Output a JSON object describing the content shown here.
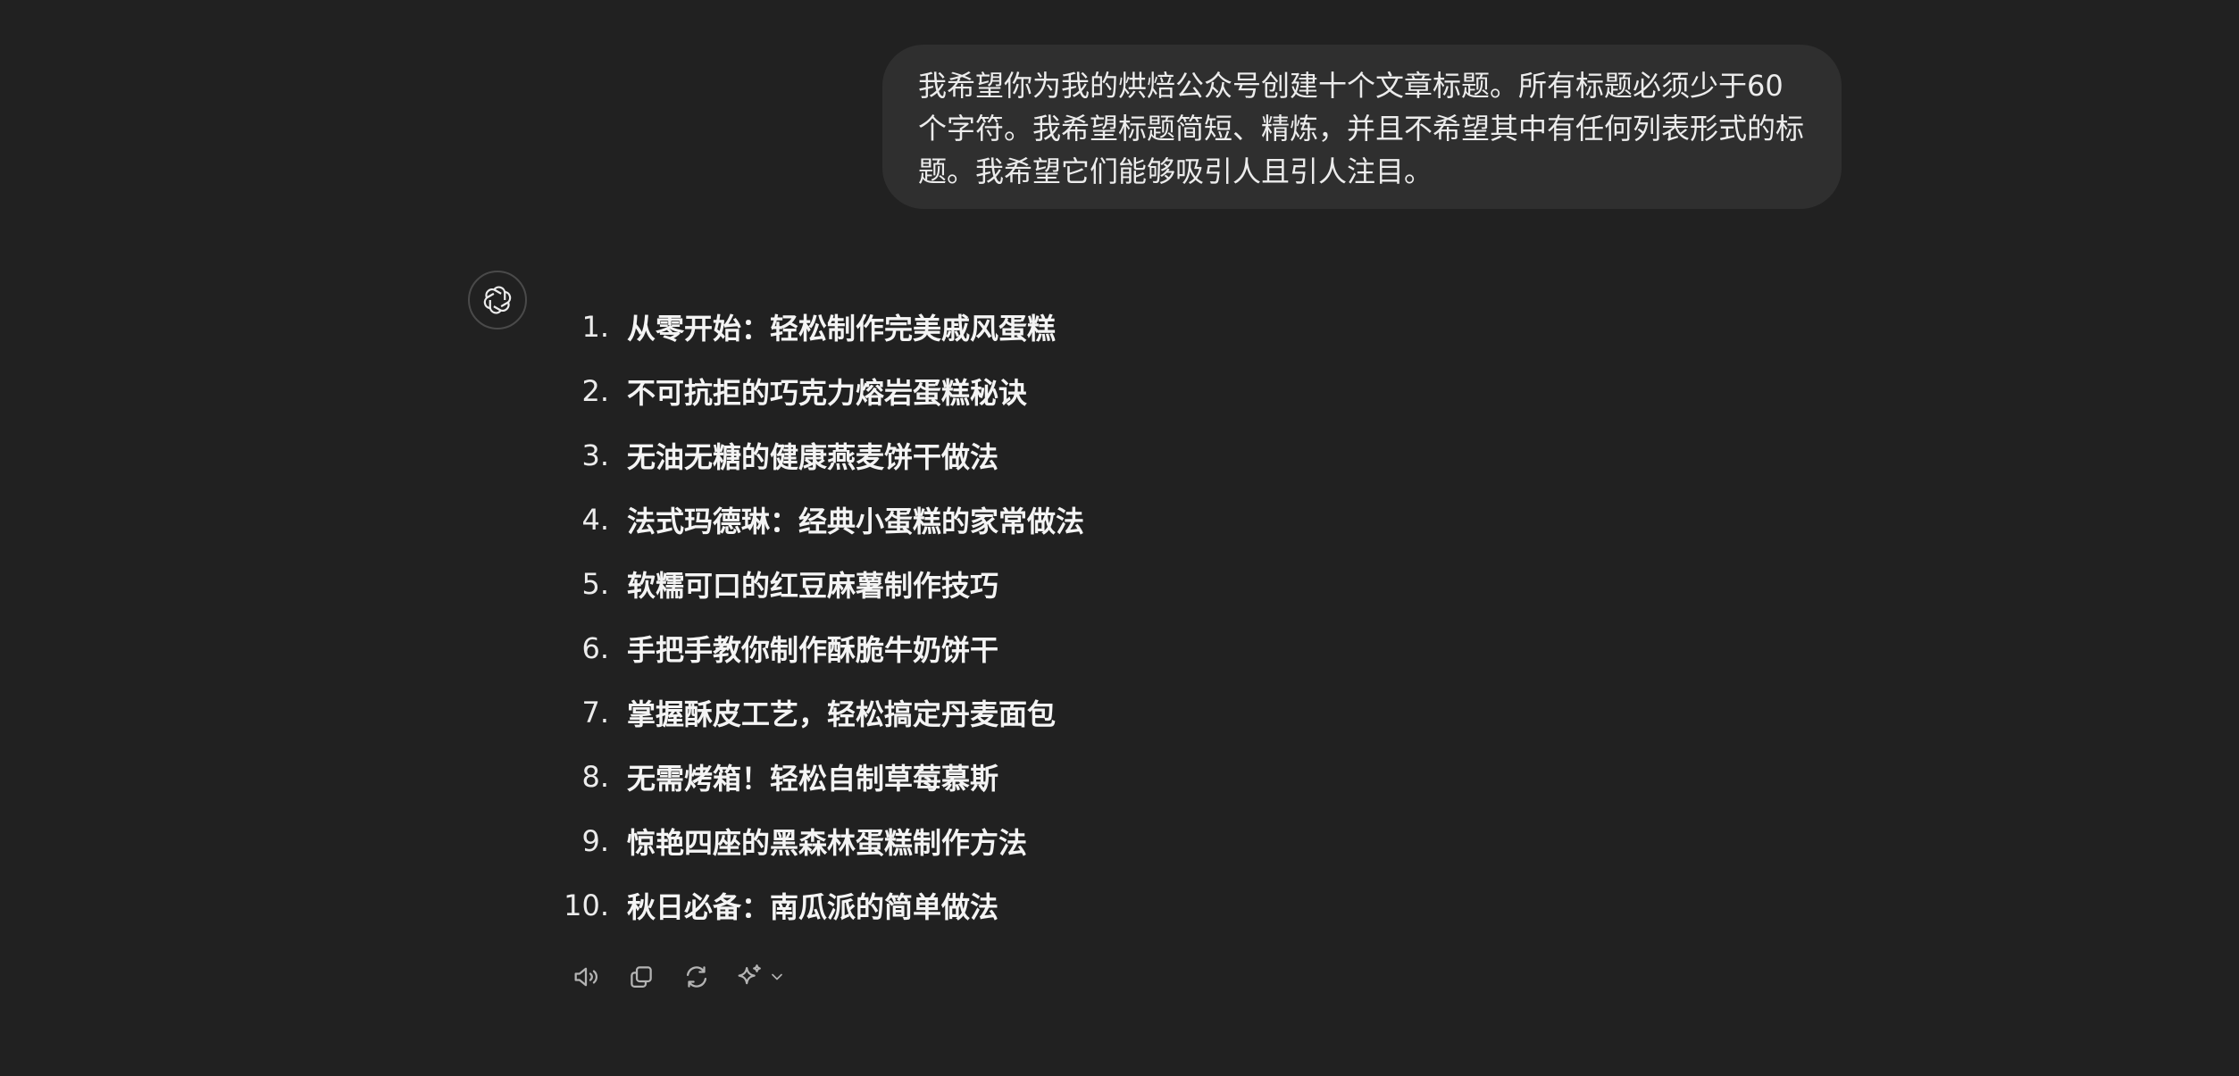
{
  "user_message": {
    "text": "我希望你为我的烘焙公众号创建十个文章标题。所有标题必须少于60个字符。我希望标题简短、精炼，并且不希望其中有任何列表形式的标题。我希望它们能够吸引人且引人注目。"
  },
  "assistant": {
    "avatar_icon": "openai-logo-icon",
    "items": [
      {
        "num": "1.",
        "text": "从零开始：轻松制作完美戚风蛋糕"
      },
      {
        "num": "2.",
        "text": "不可抗拒的巧克力熔岩蛋糕秘诀"
      },
      {
        "num": "3.",
        "text": "无油无糖的健康燕麦饼干做法"
      },
      {
        "num": "4.",
        "text": "法式玛德琳：经典小蛋糕的家常做法"
      },
      {
        "num": "5.",
        "text": "软糯可口的红豆麻薯制作技巧"
      },
      {
        "num": "6.",
        "text": "手把手教你制作酥脆牛奶饼干"
      },
      {
        "num": "7.",
        "text": "掌握酥皮工艺，轻松搞定丹麦面包"
      },
      {
        "num": "8.",
        "text": "无需烤箱！轻松自制草莓慕斯"
      },
      {
        "num": "9.",
        "text": "惊艳四座的黑森林蛋糕制作方法"
      },
      {
        "num": "10.",
        "text": "秋日必备：南瓜派的简单做法"
      }
    ]
  },
  "actions": {
    "icons": [
      "speaker-icon",
      "copy-icon",
      "regenerate-icon",
      "sparkle-icon",
      "chevron-down-icon"
    ]
  },
  "colors": {
    "background": "#212121",
    "bubble": "#2f2f2f",
    "text": "#ececec",
    "icon": "#b4b4b4"
  }
}
